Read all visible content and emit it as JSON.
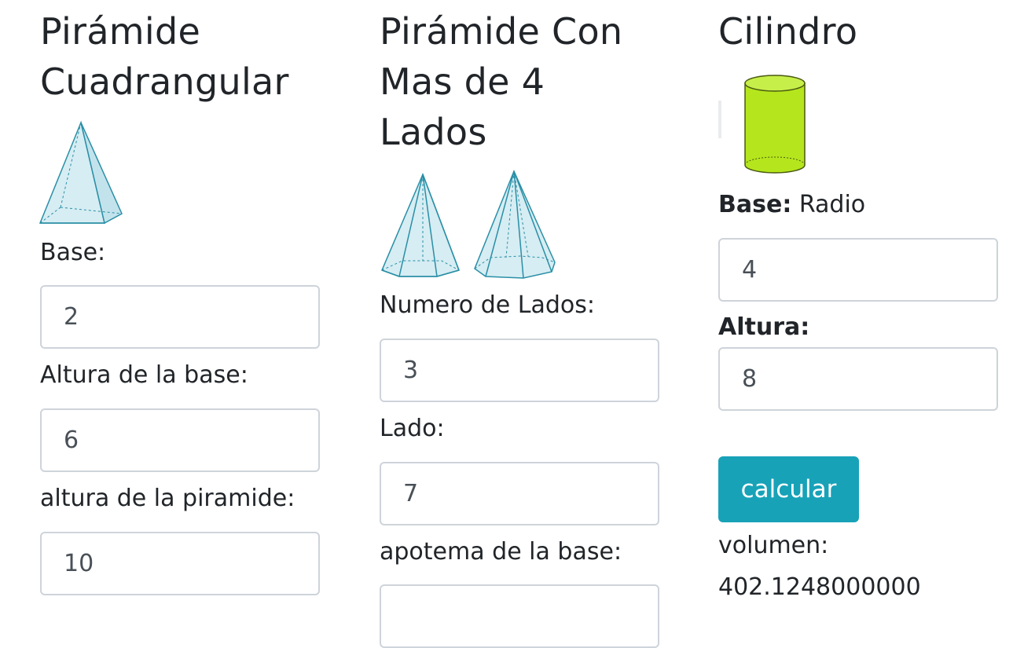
{
  "square_pyramid": {
    "title": "Pirámide Cuadrangular",
    "image_icon": "square-pyramid-icon",
    "fields": [
      {
        "label": "Base:",
        "value": "2"
      },
      {
        "label": "Altura de la base:",
        "value": "6"
      },
      {
        "label": "altura de la piramide:",
        "value": "10"
      }
    ]
  },
  "polygon_pyramid": {
    "title": "Pirámide Con Mas de 4 Lados",
    "image_icons": [
      "hexagonal-pyramid-icon",
      "heptagonal-pyramid-icon"
    ],
    "fields": [
      {
        "label": "Numero de Lados:",
        "value": "3"
      },
      {
        "label": "Lado:",
        "value": "7"
      },
      {
        "label": "apotema de la base:",
        "value": ""
      }
    ]
  },
  "cylinder": {
    "title": "Cilindro",
    "image_icon": "cylinder-icon",
    "base_label_bold": "Base:",
    "base_label_rest": "Radio",
    "base_value": "4",
    "height_label": "Altura:",
    "height_value": "8",
    "button_label": "calcular",
    "result_label": "volumen:",
    "result_value": "402.1248000000"
  },
  "colors": {
    "button": "#17a2b8",
    "pyramid_fill": "#cfe9f0",
    "pyramid_stroke": "#2a8fa6",
    "cylinder_fill": "#b5e61d"
  }
}
